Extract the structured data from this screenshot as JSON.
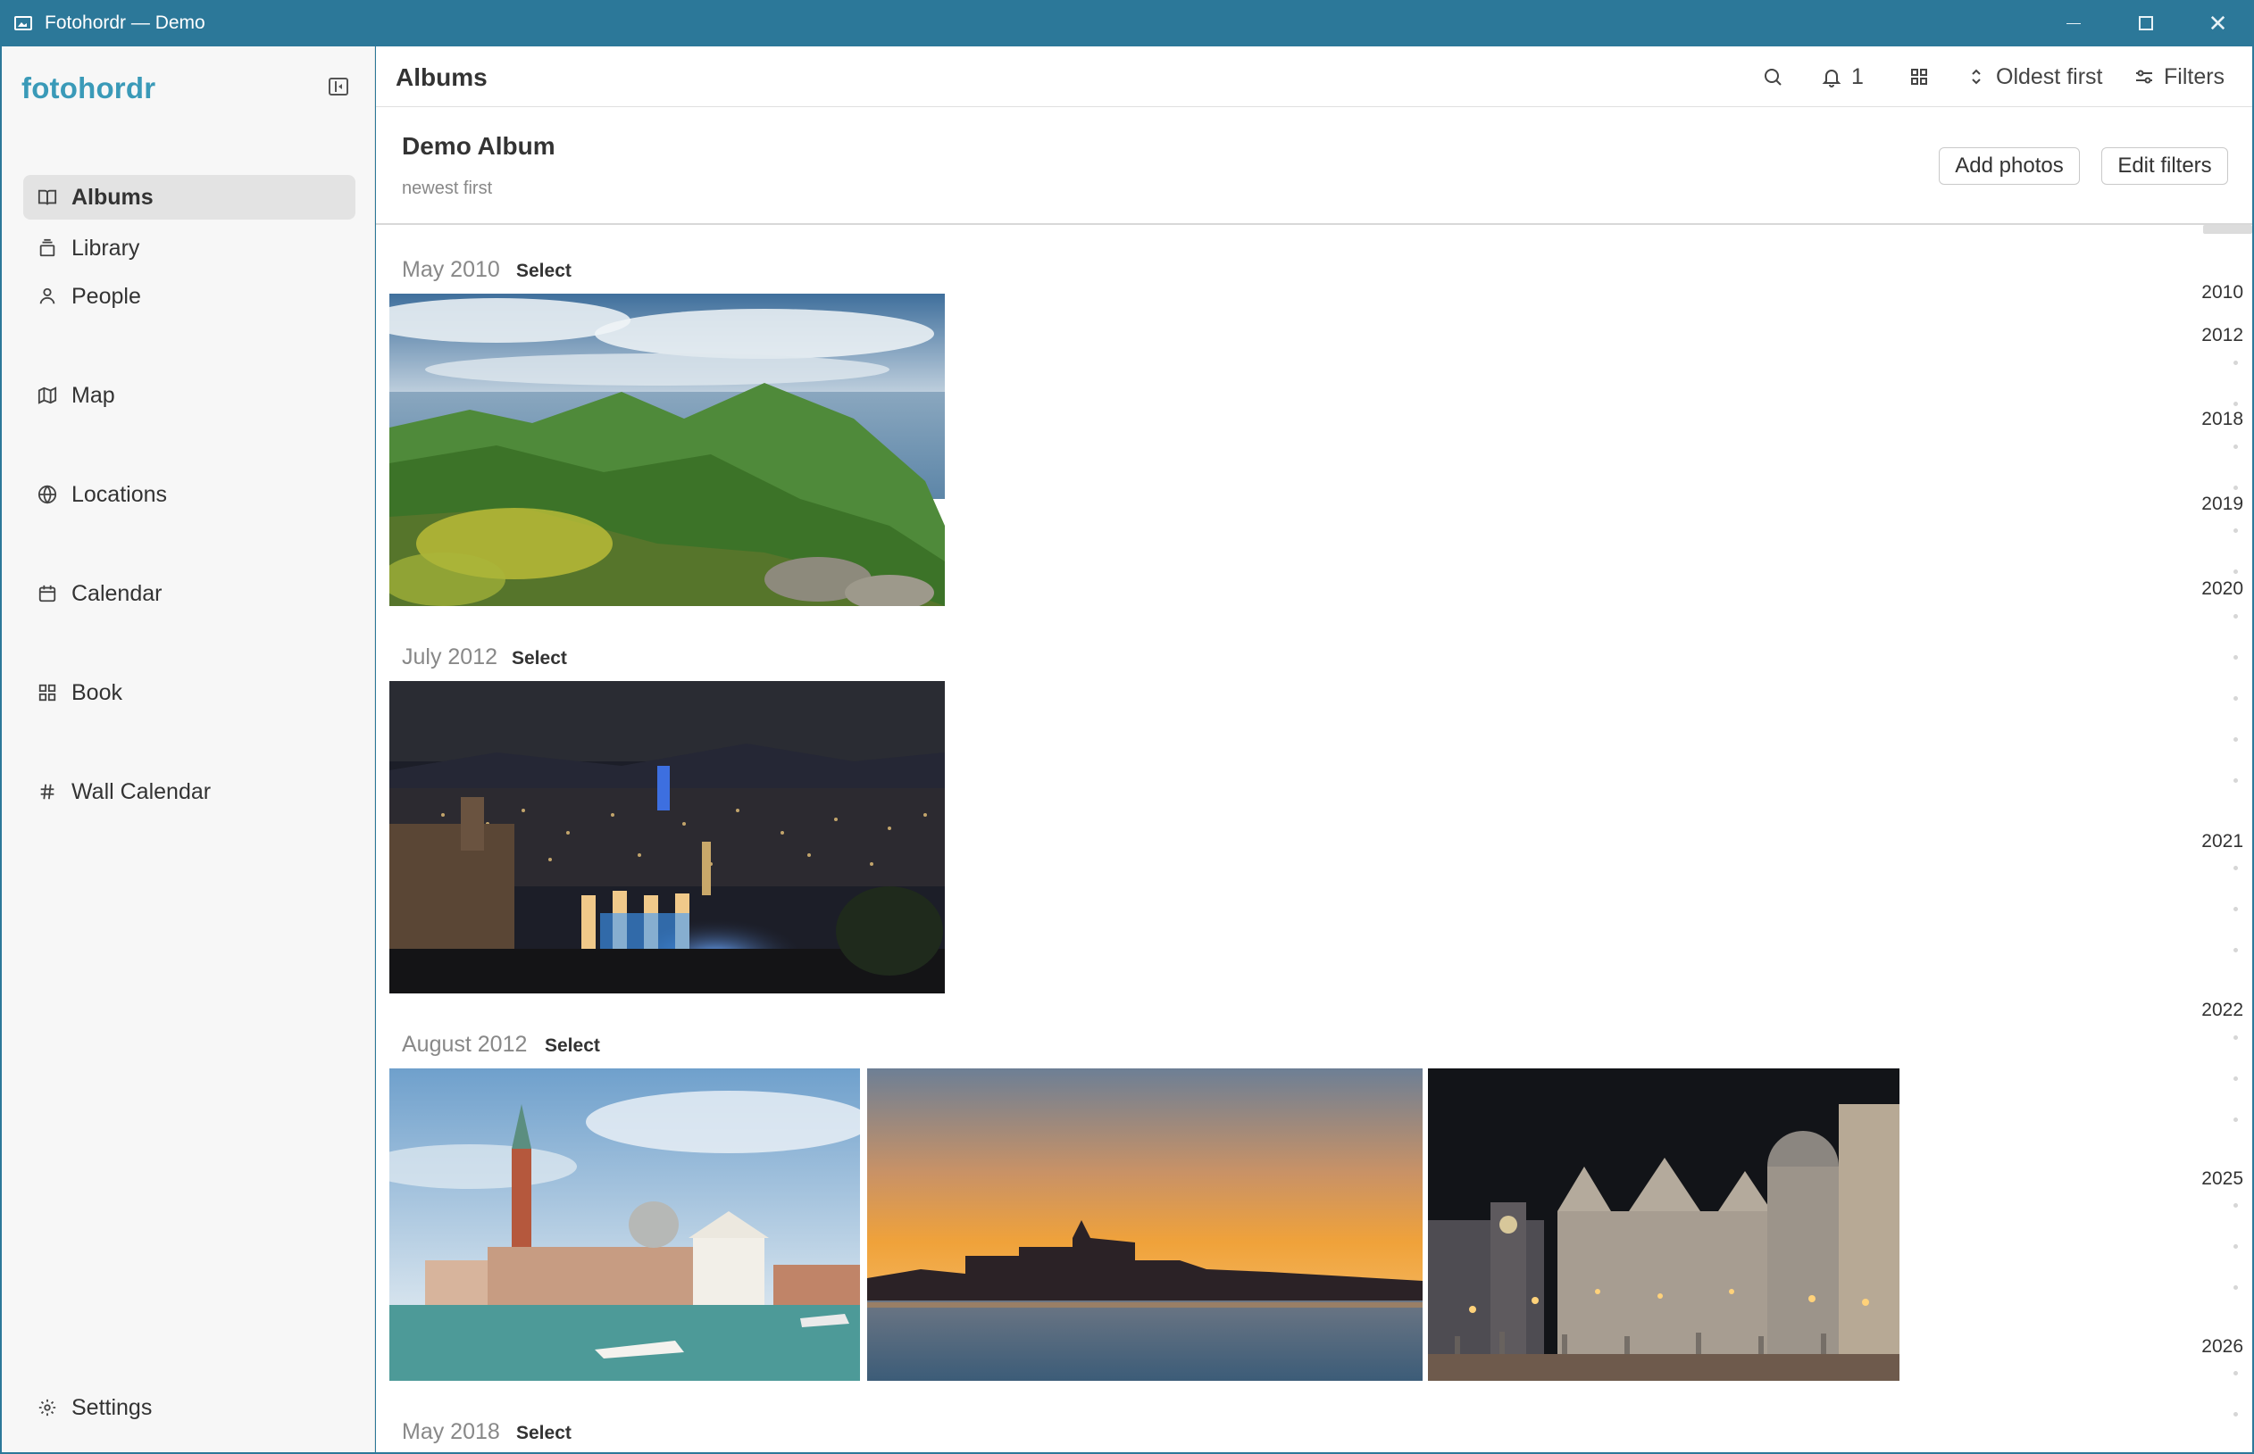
{
  "window": {
    "title": "Fotohordr — Demo"
  },
  "sidebar": {
    "brand": "fotohordr",
    "items": [
      {
        "label": "Library",
        "icon": "library-icon",
        "active": false
      },
      {
        "label": "Albums",
        "icon": "albums-icon",
        "active": true
      },
      {
        "label": "People",
        "icon": "person-icon",
        "active": false
      },
      {
        "label": "Map",
        "icon": "map-icon",
        "active": false
      },
      {
        "label": "Locations",
        "icon": "globe-icon",
        "active": false
      },
      {
        "label": "Calendar",
        "icon": "calendar-icon",
        "active": false
      },
      {
        "label": "Book",
        "icon": "grid-icon",
        "active": false
      },
      {
        "label": "Wall Calendar",
        "icon": "hash-icon",
        "active": false
      }
    ],
    "settings_label": "Settings"
  },
  "topbar": {
    "title": "Albums",
    "notification_count": "1",
    "sort_label": "Oldest first",
    "filters_label": "Filters"
  },
  "album": {
    "title": "Demo Album",
    "subtitle": "newest first",
    "add_photos_label": "Add photos",
    "edit_filters_label": "Edit filters"
  },
  "sections": [
    {
      "month": "May 2010",
      "select_label": "Select",
      "photos": [
        "green-coastal-hills"
      ]
    },
    {
      "month": "July 2012",
      "select_label": "Select",
      "photos": [
        "city-night-fountain"
      ]
    },
    {
      "month": "August 2012",
      "select_label": "Select",
      "photos": [
        "venice-church-island",
        "venice-sunset",
        "venice-square-night"
      ]
    },
    {
      "month": "May 2018",
      "select_label": "Select",
      "photos": []
    }
  ],
  "timeline": {
    "years": [
      "2010",
      "2012",
      "2018",
      "2019",
      "2020",
      "2021",
      "2022",
      "2025",
      "2026"
    ]
  }
}
